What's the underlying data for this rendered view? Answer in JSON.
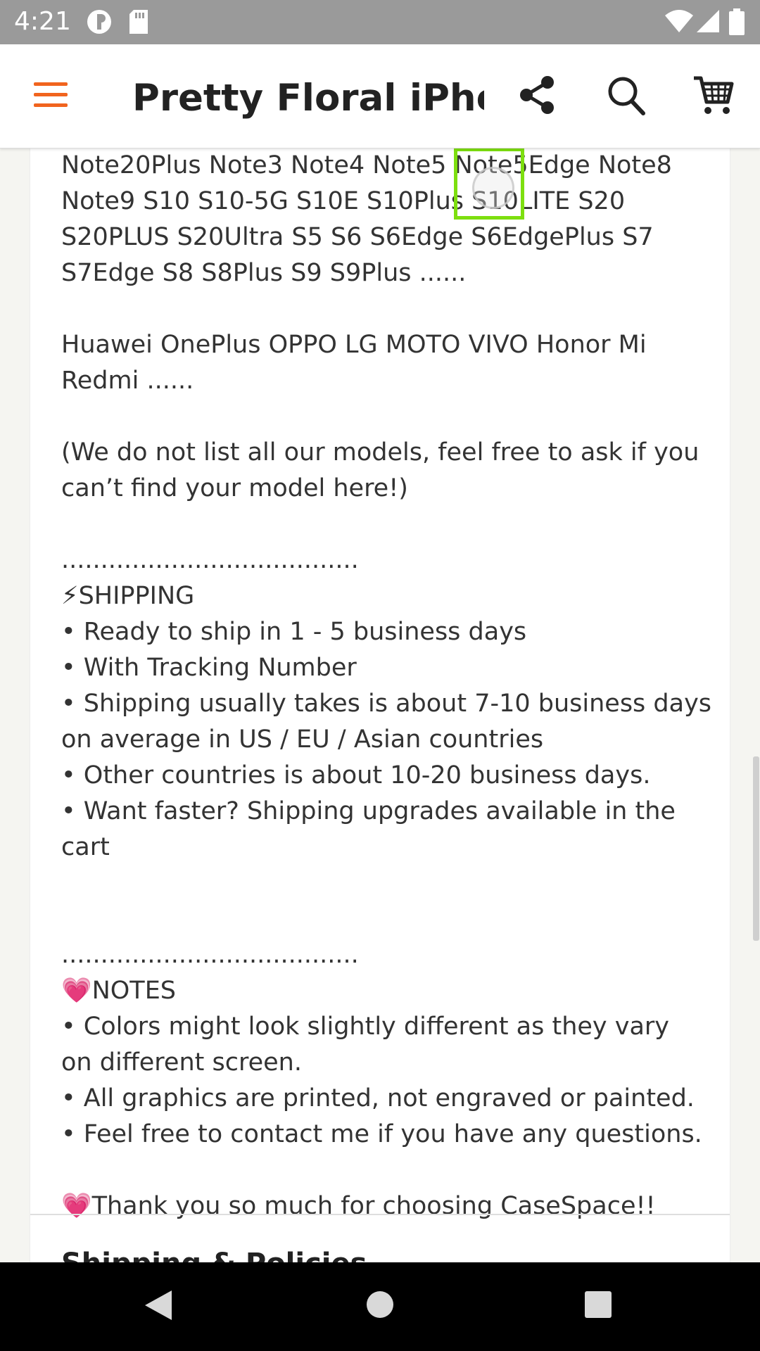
{
  "status_bar": {
    "time": "4:21",
    "icons": [
      "sync-icon",
      "sd-card-icon",
      "wifi-icon",
      "signal-icon",
      "battery-icon"
    ]
  },
  "app_bar": {
    "title": "Pretty Floral iPho...",
    "menu_icon": "hamburger-menu-icon",
    "share_icon": "share-icon",
    "search_icon": "search-icon",
    "cart_icon": "cart-icon",
    "accent_color": "#f1641e"
  },
  "description": {
    "lines": [
      "Note20Plus Note3 Note4 Note5 Note5Edge Note8",
      "Note9 S10 S10-5G S10E S10Plus S10LITE S20",
      "S20PLUS S20Ultra S5 S6 S6Edge S6EdgePlus S7",
      "S7Edge S8 S8Plus S9 S9Plus ......",
      "",
      "Huawei OnePlus OPPO LG MOTO VIVO Honor Mi",
      "Redmi ......",
      "",
      "(We do not list all our models, feel free to ask if you",
      "can’t find your model here!)",
      "",
      "......................................",
      "⚡SHIPPING",
      "• Ready to ship in 1 - 5 business days",
      "• With Tracking Number",
      "• Shipping usually takes is about 7-10 business days",
      "on average in US / EU / Asian countries",
      "• Other countries is about 10-20 business days.",
      "• Want faster? Shipping upgrades available in the",
      "cart",
      "",
      "",
      "......................................",
      "💗NOTES",
      "• Colors might look slightly different as they vary",
      "on different screen.",
      "• All graphics are printed, not engraved or painted.",
      "• Feel free to contact me if you have any questions.",
      "",
      "💗Thank you so much for choosing CaseSpace!!"
    ]
  },
  "next_section": {
    "title": "Shipping & Policies"
  },
  "touch_indicator": {
    "label": "touch: 100%",
    "color": "#7ddf0f"
  },
  "nav_bar": {
    "back_icon": "back-triangle-icon",
    "home_icon": "home-circle-icon",
    "recents_icon": "recents-square-icon"
  }
}
